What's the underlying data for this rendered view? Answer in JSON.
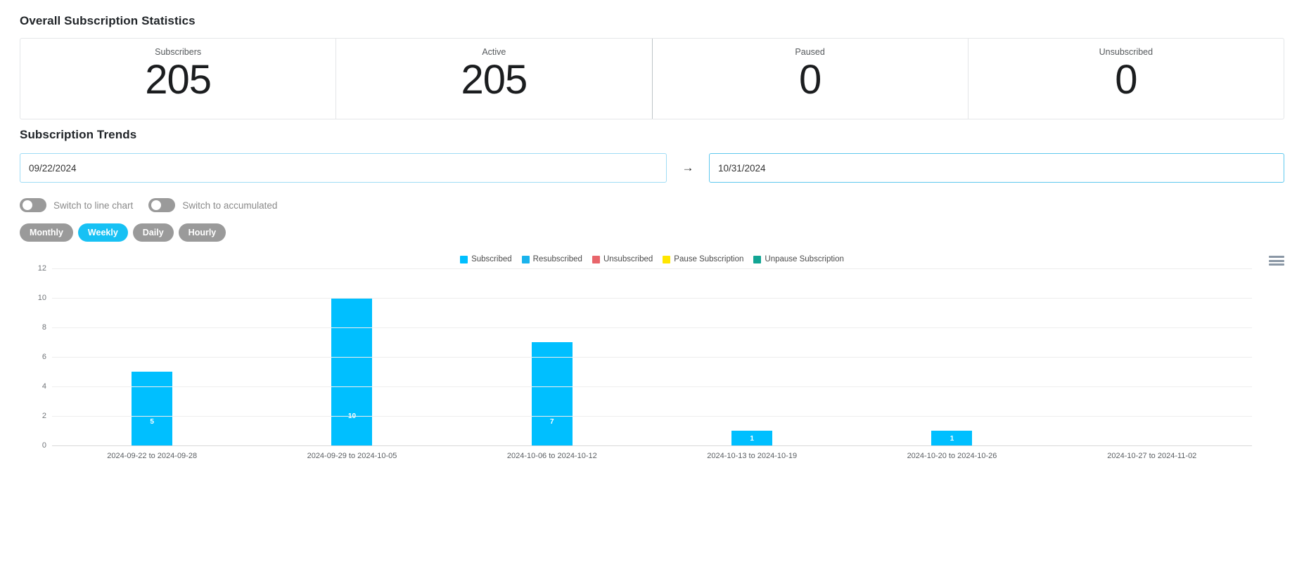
{
  "overall": {
    "title": "Overall Subscription Statistics",
    "cards": [
      {
        "label": "Subscribers",
        "value": "205"
      },
      {
        "label": "Active",
        "value": "205"
      },
      {
        "label": "Paused",
        "value": "0"
      },
      {
        "label": "Unsubscribed",
        "value": "0"
      }
    ]
  },
  "trends": {
    "title": "Subscription Trends",
    "date_range": {
      "start_value": "09/22/2024",
      "start_placeholder": "MM/DD/YYYY",
      "end_value": "10/31/2024",
      "end_placeholder": "MM/DD/YYYY",
      "separator_icon": "arrow-right-icon",
      "separator_glyph": "→"
    },
    "toggles": [
      {
        "label": "Switch to line chart",
        "state": "off"
      },
      {
        "label": "Switch to accumulated",
        "state": "off"
      }
    ],
    "periods": [
      {
        "label": "Monthly",
        "active": false
      },
      {
        "label": "Weekly",
        "active": true
      },
      {
        "label": "Daily",
        "active": false
      },
      {
        "label": "Hourly",
        "active": false
      }
    ],
    "menu_icon": "hamburger-menu-icon"
  },
  "colors": {
    "accent": "#00bfff",
    "pill_active": "#17c1f4",
    "pill_inactive": "#9a9a9a",
    "toggle_off": "#9a9a9a",
    "input_border": "#9fdcf5",
    "input_border_focus": "#5ec8ee",
    "card_border": "#e4e6e8"
  },
  "chart_data": {
    "type": "bar",
    "title": "",
    "xlabel": "",
    "ylabel": "",
    "ylim": [
      0,
      12
    ],
    "yticks": [
      0,
      2,
      4,
      6,
      8,
      10,
      12
    ],
    "grid": true,
    "legend_position": "top-center",
    "categories": [
      "2024-09-22 to 2024-09-28",
      "2024-09-29 to 2024-10-05",
      "2024-10-06 to 2024-10-12",
      "2024-10-13 to 2024-10-19",
      "2024-10-20 to 2024-10-26",
      "2024-10-27 to 2024-11-02"
    ],
    "series": [
      {
        "name": "Subscribed",
        "color": "#00bfff",
        "values": [
          5,
          10,
          7,
          1,
          1,
          0
        ],
        "labels": [
          "5",
          "10",
          "7",
          "1",
          "1",
          ""
        ]
      },
      {
        "name": "Resubscribed",
        "color": "#1ab3ec",
        "values": [
          0,
          0,
          0,
          0,
          0,
          0
        ]
      },
      {
        "name": "Unsubscribed",
        "color": "#e8656b",
        "values": [
          0,
          0,
          0,
          0,
          0,
          0
        ]
      },
      {
        "name": "Pause Subscription",
        "color": "#ffe600",
        "values": [
          0,
          0,
          0,
          0,
          0,
          0
        ]
      },
      {
        "name": "Unpause Subscription",
        "color": "#12a594",
        "values": [
          0,
          0,
          0,
          0,
          0,
          0
        ]
      }
    ]
  }
}
